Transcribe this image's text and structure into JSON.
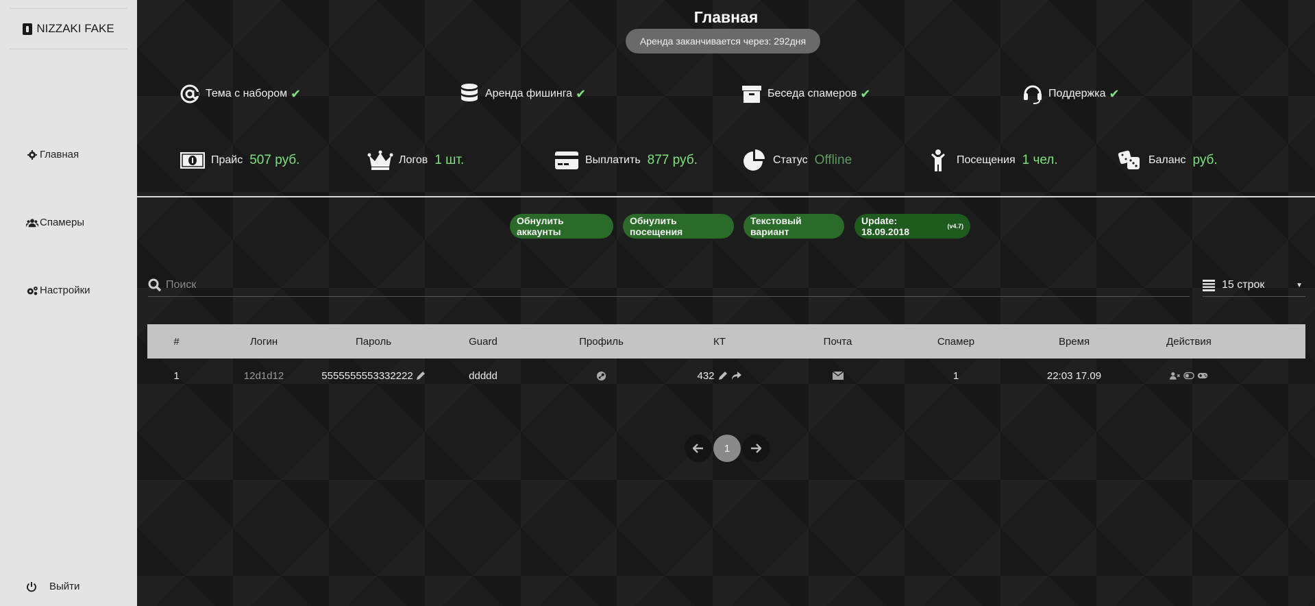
{
  "sidebar": {
    "brand": "NIZZAKI FAKE",
    "items": [
      {
        "label": "Главная"
      },
      {
        "label": "Спамеры"
      },
      {
        "label": "Настройки"
      }
    ],
    "logout": "Выйти"
  },
  "header": {
    "title": "Главная",
    "rent_notice": "Аренда заканчивается через: 292дня"
  },
  "features": [
    {
      "label": "Тема с набором",
      "icon": "at-icon"
    },
    {
      "label": "Аренда фишинга",
      "icon": "database-icon"
    },
    {
      "label": "Беседа спамеров",
      "icon": "archive-icon"
    },
    {
      "label": "Поддержка",
      "icon": "headset-icon"
    }
  ],
  "stats": [
    {
      "label": "Прайс",
      "value": "507 руб.",
      "icon": "money-icon"
    },
    {
      "label": "Логов",
      "value": "1 шт.",
      "icon": "crown-icon"
    },
    {
      "label": "Выплатить",
      "value": "877 руб.",
      "icon": "credit-card-icon"
    },
    {
      "label": "Статус",
      "value": "Offline",
      "icon": "pie-chart-icon"
    },
    {
      "label": "Посещения",
      "value": "1 чел.",
      "icon": "person-icon"
    },
    {
      "label": "Баланс",
      "value": "руб.",
      "icon": "dice-icon"
    }
  ],
  "actions": {
    "reset_accounts": "Обнулить аккаунты",
    "reset_visits": "Обнулить посещения",
    "text_variant": "Текстовый вариант",
    "update": "Update: 18.09.2018",
    "version": "(v4.7)"
  },
  "search": {
    "placeholder": "Поиск"
  },
  "rows_select": {
    "value": "15 строк"
  },
  "table": {
    "columns": [
      "#",
      "Логин",
      "Пароль",
      "Guard",
      "Профиль",
      "КТ",
      "Почта",
      "Спамер",
      "Время",
      "Действия"
    ],
    "rows": [
      {
        "num": "1",
        "login": "12d1d12",
        "password": "5555555553332222",
        "guard": "ddddd",
        "kt": "432",
        "spammer": "1",
        "time": "22:03 17.09"
      }
    ]
  },
  "pagination": {
    "current": "1"
  },
  "colors": {
    "accent_green": "#7ce37c",
    "button_green": "#2a6b2a",
    "sidebar_bg": "#e4e4e4"
  }
}
